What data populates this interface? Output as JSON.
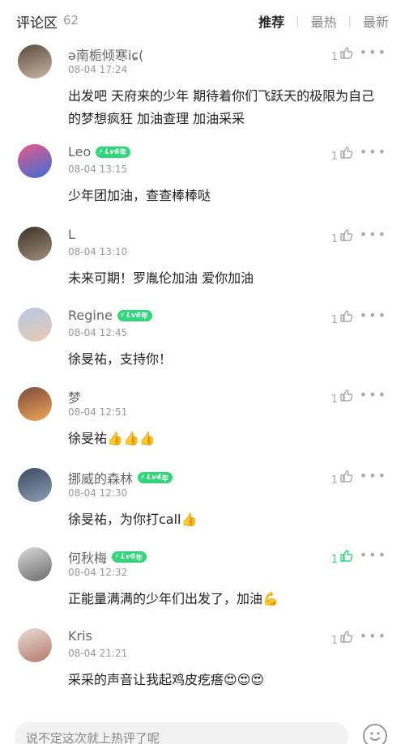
{
  "header": {
    "title": "评论区",
    "count": "62",
    "tabs": [
      {
        "label": "推荐",
        "active": true
      },
      {
        "label": "最热",
        "active": false
      },
      {
        "label": "最新",
        "active": false
      }
    ],
    "separator": "|"
  },
  "comments": [
    {
      "username": "ə南栀倾寒iɕ(",
      "time": "08-04 17:24",
      "text": "出发吧 天府来的少年 期待着你们飞跃天的极限为自己的梦想疯狂 加油查理 加油采采",
      "likes": "1",
      "badge": null,
      "avatar_colors": [
        "#5a4a3d",
        "#c9b8a4"
      ]
    },
    {
      "username": "Leo",
      "time": "08-04 13:15",
      "text": "少年团加油，查查棒棒哒",
      "likes": "1",
      "badge": "Lv6",
      "avatar_colors": [
        "#e85a8a",
        "#3a6fd8"
      ]
    },
    {
      "username": "L",
      "time": "08-04 13:10",
      "text": "未来可期！罗胤伦加油 爱你加油",
      "likes": "1",
      "badge": null,
      "avatar_colors": [
        "#3b3128",
        "#a08f7a"
      ]
    },
    {
      "username": "Regine",
      "time": "08-04 12:45",
      "text": "徐旻祐，支持你！",
      "likes": "1",
      "badge": "Lv6",
      "avatar_colors": [
        "#b7c9e8",
        "#e8c9b0"
      ]
    },
    {
      "username": "梦",
      "time": "08-04 12:51",
      "text": "徐旻祐",
      "emoji": "👍👍👍",
      "likes": "1",
      "badge": null,
      "avatar_colors": [
        "#7a4a3a",
        "#f3a65a"
      ]
    },
    {
      "username": "挪威的森林",
      "time": "08-04 12:30",
      "text": "徐旻祐，为你打call",
      "emoji": "👍",
      "likes": "1",
      "badge": "Lv4",
      "avatar_colors": [
        "#3b4a5e",
        "#8e9fb3"
      ]
    },
    {
      "username": "何秋梅",
      "time": "08-04 12:32",
      "text": "正能量满满的少年们出发了，加油",
      "emoji": "💪",
      "likes": "1",
      "likes_green": true,
      "badge": "Lv6",
      "avatar_colors": [
        "#d9d9d9",
        "#6b6b6b"
      ]
    },
    {
      "username": "Kris",
      "time": "08-04 21:21",
      "text": "采采的声音让我起鸡皮疙瘩",
      "emoji": "😍😍😍",
      "likes": "1",
      "badge": null,
      "avatar_colors": [
        "#e8ddd4",
        "#b47a6a"
      ]
    }
  ],
  "badge_suffix": "年",
  "more_label": "•••",
  "footer": {
    "placeholder": "说不定这次就上热评了呢"
  },
  "colors": {
    "accent": "#2fd67a",
    "muted": "#999999"
  },
  "icons": [
    "thumbs-up-icon",
    "more-icon",
    "emoji-icon",
    "bolt-icon"
  ]
}
